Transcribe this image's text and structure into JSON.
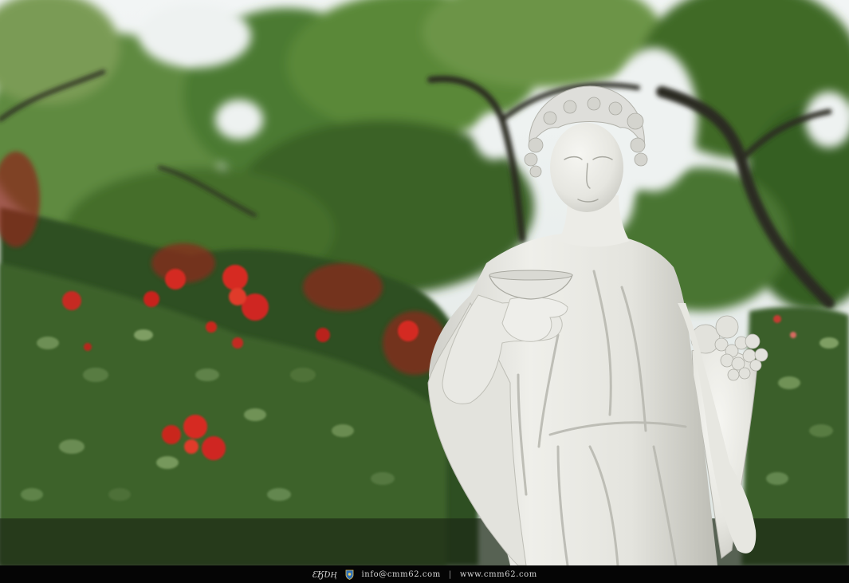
{
  "photo": {
    "subject": "marble-statue-with-bowl-and-cornucopia",
    "background": "red-rose-bushes-under-trees",
    "colors": {
      "sky": "#e9eef0",
      "foliage_dark": "#2d4a22",
      "foliage_mid": "#4f7a36",
      "foliage_light": "#8fb268",
      "rose_red": "#d42a22",
      "marble": "#ebebe6",
      "marble_shadow": "#bdbdb6",
      "footer_bg": "#050505"
    }
  },
  "watermark": {
    "signature": "ƐӃƲӉ",
    "logo_icon": "shield-logo-icon",
    "email": "info@cmm62.com",
    "separator": "|",
    "website": "www.cmm62.com"
  }
}
